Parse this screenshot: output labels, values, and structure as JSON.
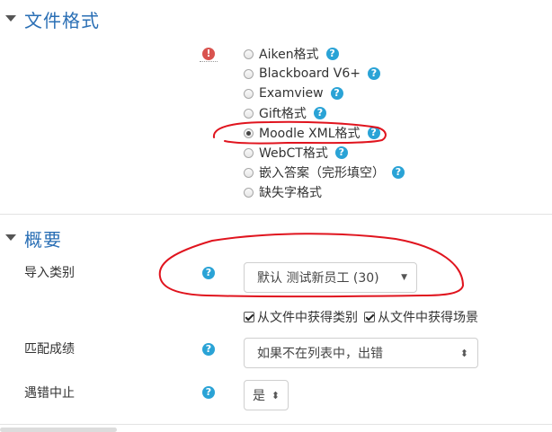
{
  "file_format": {
    "title": "文件格式",
    "options": [
      {
        "label": "Aiken格式",
        "checked": false
      },
      {
        "label": "Blackboard V6+",
        "checked": false
      },
      {
        "label": "Examview",
        "checked": false
      },
      {
        "label": "Gift格式",
        "checked": false
      },
      {
        "label": "Moodle XML格式",
        "checked": true
      },
      {
        "label": "WebCT格式",
        "checked": false
      },
      {
        "label": "嵌入答案（完形填空）",
        "checked": false
      },
      {
        "label": "缺失字格式",
        "checked": false
      }
    ]
  },
  "general": {
    "title": "概要",
    "import_category": {
      "label": "导入类别",
      "selected": "默认 测试新员工 (30)"
    },
    "checkboxes": [
      {
        "label": "从文件中获得类别",
        "checked": true
      },
      {
        "label": "从文件中获得场景",
        "checked": true
      }
    ],
    "match_grades": {
      "label": "匹配成绩",
      "selected": "如果不在列表中，出错"
    },
    "stop_on_error": {
      "label": "遇错中止",
      "selected": "是"
    }
  },
  "icons": {
    "help": "?",
    "required": "!"
  },
  "colors": {
    "section_title": "#2a6fb5",
    "help_icon": "#2aa3d6",
    "required_icon": "#d9534f",
    "annotation": "#e0141e"
  }
}
